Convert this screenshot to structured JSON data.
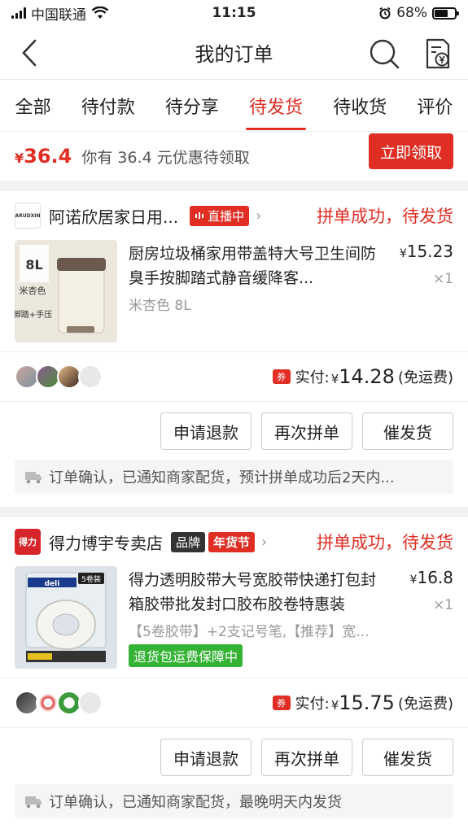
{
  "status_bar": {
    "carrier": "中国联通",
    "time": "11:15",
    "battery": "68%",
    "battery_level": 0.68
  },
  "nav": {
    "title": "我的订单",
    "icons": [
      "back-icon",
      "search-icon",
      "bill-icon"
    ]
  },
  "tabs": [
    {
      "label": "全部",
      "active": false
    },
    {
      "label": "待付款",
      "active": false
    },
    {
      "label": "待分享",
      "active": false
    },
    {
      "label": "待发货",
      "active": true
    },
    {
      "label": "待收货",
      "active": false
    },
    {
      "label": "评价",
      "active": false
    }
  ],
  "coupon": {
    "currency": "¥",
    "amount": "36.4",
    "text": "你有 36.4 元优惠待领取",
    "button": "立即领取"
  },
  "orders": [
    {
      "shop_logo": "ARUDXIN",
      "shop_name": "阿诺欣居家日用...",
      "badge": "直播中",
      "status": "拼单成功，待发货",
      "product": {
        "title": "厨房垃圾桶家用带盖特大号卫生间防臭手按脚踏式静音缓降客...",
        "spec": "米杏色 8L",
        "currency": "¥",
        "price": "15.23",
        "qty": "×1",
        "image_labels": {
          "size": "8L",
          "color": "米杏色",
          "mode": "脚踏+手压"
        }
      },
      "paid": {
        "chip": "券",
        "label": "实付:",
        "currency": "¥",
        "amount": "14.28",
        "note": "(免运费)"
      },
      "actions": [
        "申请退款",
        "再次拼单",
        "催发货"
      ],
      "notice": "订单确认，已通知商家配货，预计拼单成功后2天内..."
    },
    {
      "shop_logo": "得力",
      "shop_name": "得力博宇专卖店",
      "badges": [
        "品牌",
        "年货节"
      ],
      "status": "拼单成功，待发货",
      "product": {
        "title": "得力透明胶带大号宽胶带快递打包封箱胶带批发封口胶布胶卷特惠装",
        "spec": "【5卷胶带】+2支记号笔,【推荐】宽...",
        "currency": "¥",
        "price": "16.8",
        "qty": "×1",
        "guarantee": "退货包运费保障中",
        "image_labels": {
          "pack": "5卷装",
          "brand": "deli"
        }
      },
      "paid": {
        "chip": "券",
        "label": "实付:",
        "currency": "¥",
        "amount": "15.75",
        "note": "(免运费)"
      },
      "actions": [
        "申请退款",
        "再次拼单",
        "催发货"
      ],
      "notice": "订单确认，已通知商家配货，最晚明天内发货"
    }
  ],
  "colors": {
    "accent": "#e02e24",
    "guarantee": "#34b233",
    "background": "#f2f2f2"
  }
}
